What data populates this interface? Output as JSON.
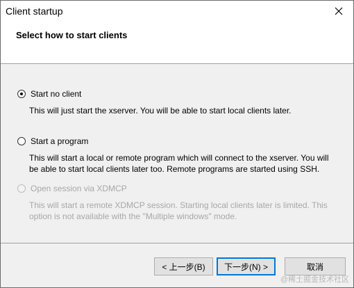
{
  "window": {
    "title": "Client startup"
  },
  "header": {
    "title": "Select how to start clients"
  },
  "options": [
    {
      "label": "Start no client",
      "description": "This will just start the xserver. You will be able to start local clients later.",
      "checked": true,
      "disabled": false
    },
    {
      "label": "Start a program",
      "description": "This will start a local or remote program which will connect to the xserver. You will be able to start local clients later too. Remote programs are started using SSH.",
      "checked": false,
      "disabled": false
    },
    {
      "label": "Open session via XDMCP",
      "description": "This will start a remote XDMCP session. Starting local clients later is limited. This option is not available with the \"Multiple windows\" mode.",
      "checked": false,
      "disabled": true
    }
  ],
  "buttons": {
    "back": "< 上一步(B)",
    "next": "下一步(N) >",
    "cancel": "取消"
  },
  "watermark": "@稀土掘金技术社区",
  "colors": {
    "disabled_text": "#a7a7a7",
    "default_button_border": "#0078d7"
  }
}
